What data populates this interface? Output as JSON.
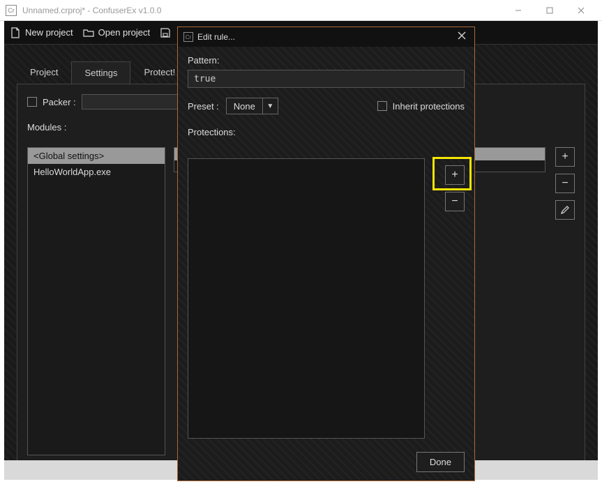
{
  "titlebar": {
    "app_icon_glyph": "Cr",
    "title": "Unnamed.crproj* - ConfuserEx v1.0.0"
  },
  "toolbar": {
    "new_project": "New project",
    "open_project": "Open project"
  },
  "tabs": {
    "project": "Project",
    "settings": "Settings",
    "protect": "Protect!"
  },
  "packer": {
    "label": "Packer :",
    "value": ""
  },
  "modules": {
    "label": "Modules :",
    "items": [
      "<Global settings>",
      "HelloWorldApp.exe"
    ],
    "selected_index": 0
  },
  "right_buttons": {
    "add": "+",
    "remove": "−",
    "edit_glyph": "✎"
  },
  "dialog": {
    "icon_glyph": "Cr",
    "title": "Edit rule...",
    "pattern_label": "Pattern:",
    "pattern_value": "true",
    "preset_label": "Preset :",
    "preset_value": "None",
    "inherit_label": "Inherit protections",
    "protections_label": "Protections:",
    "add": "+",
    "remove": "−",
    "done": "Done"
  }
}
